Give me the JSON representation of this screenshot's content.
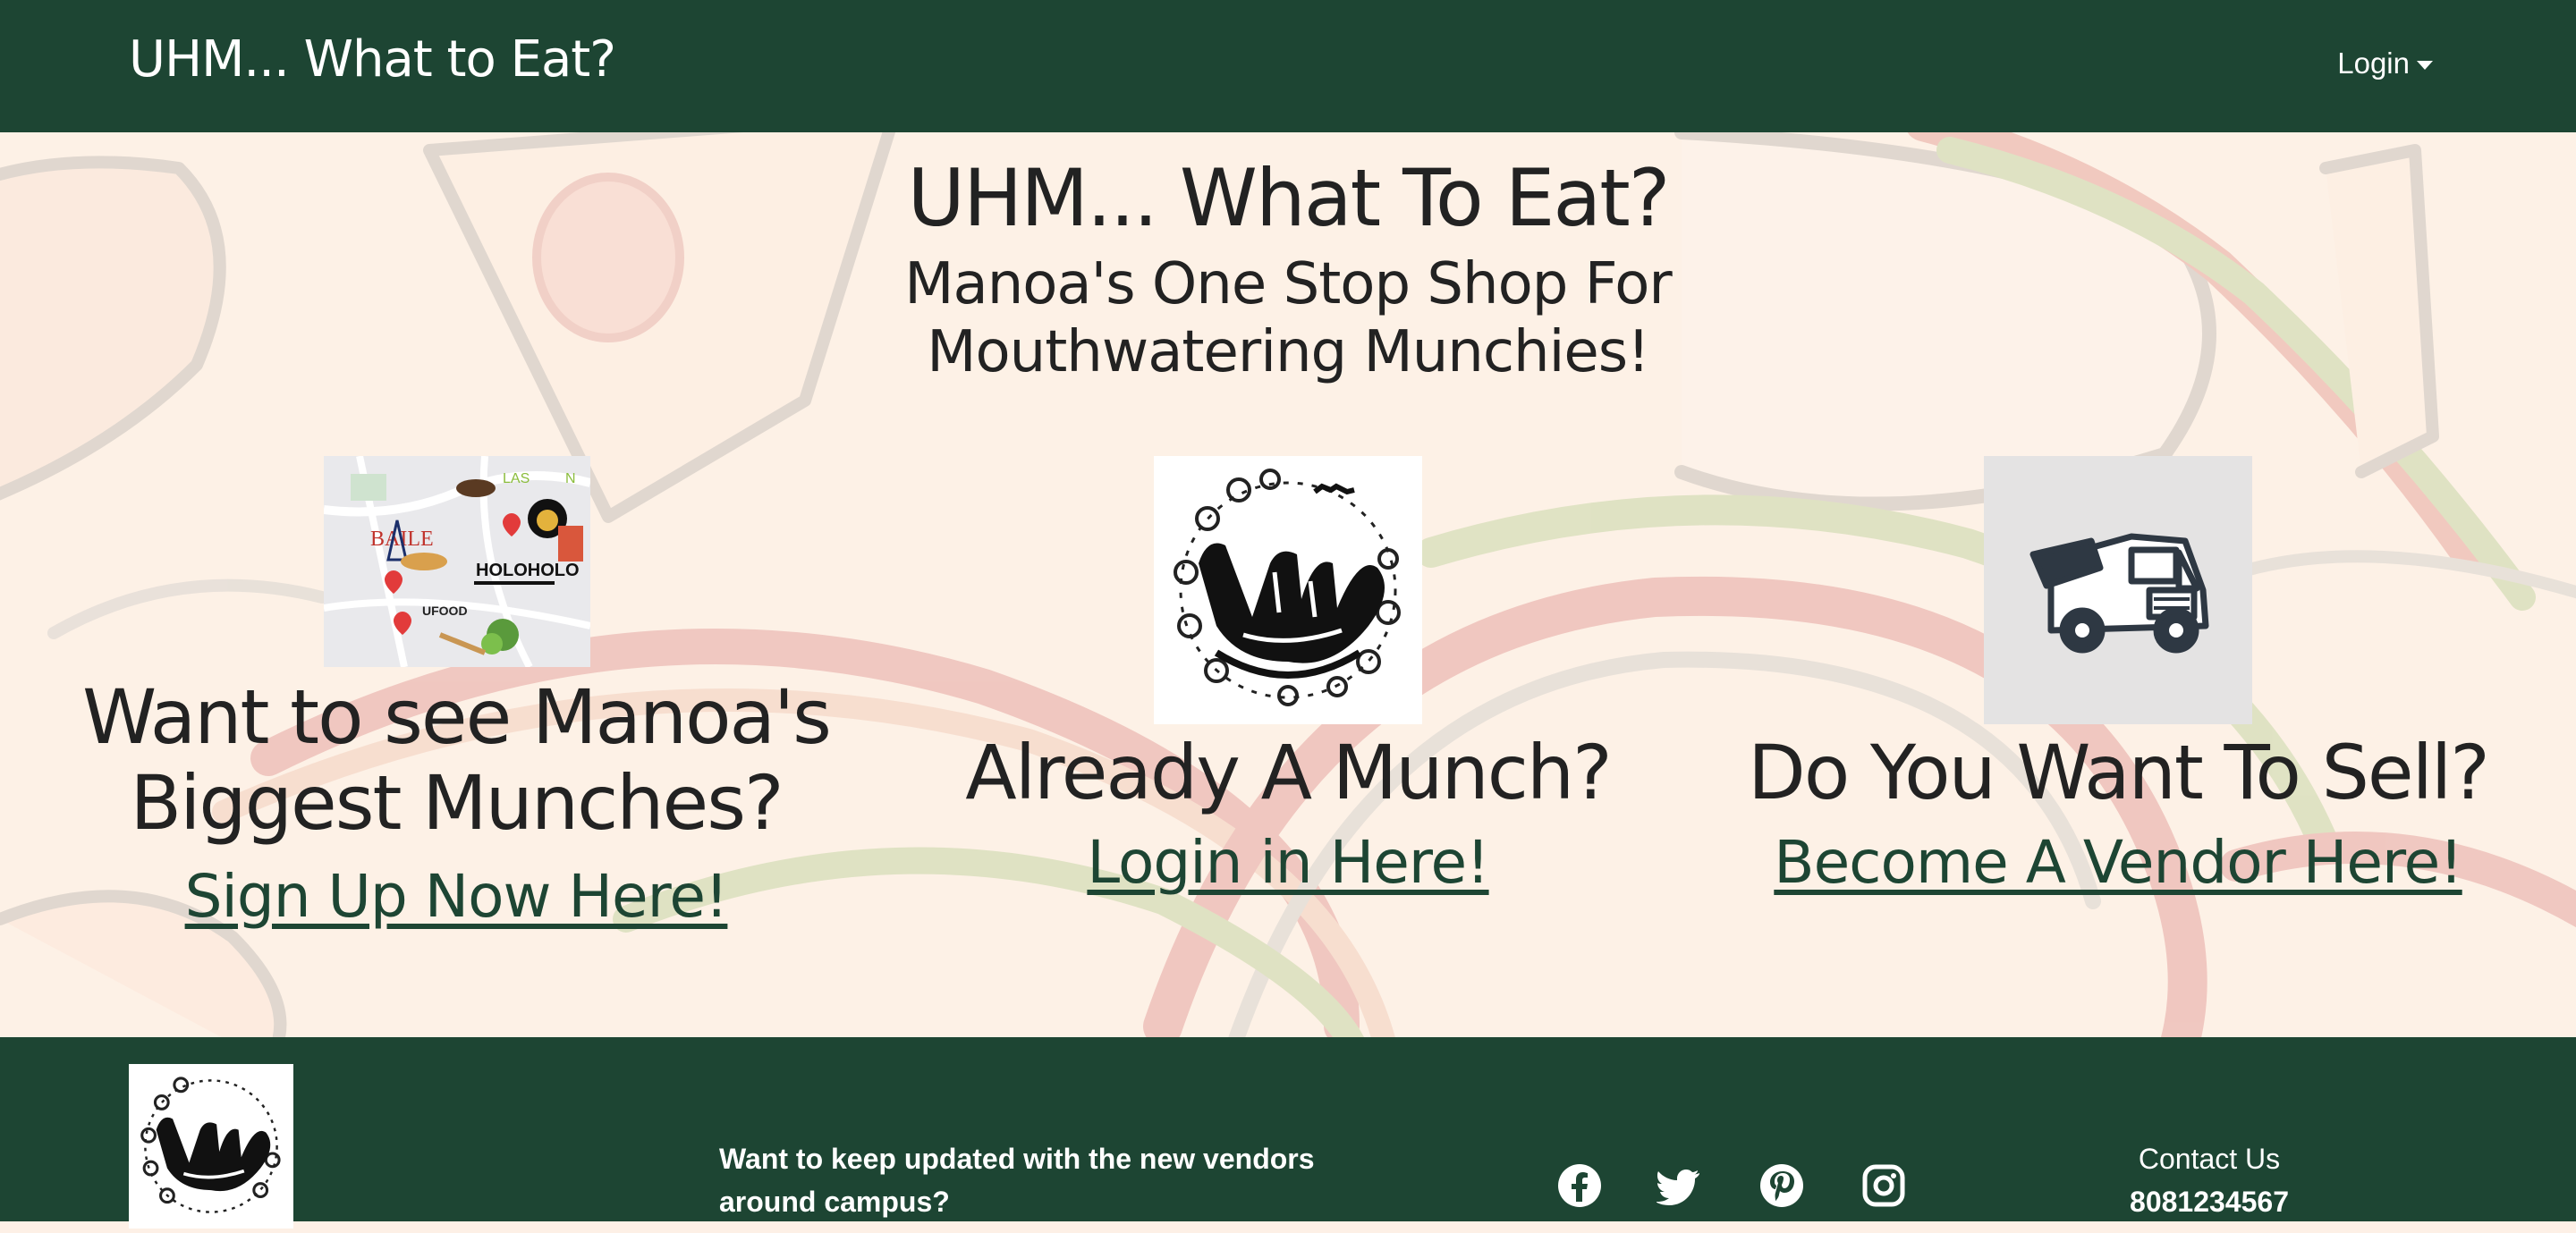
{
  "navbar": {
    "brand": "UHM... What to Eat?",
    "login_label": "Login"
  },
  "hero": {
    "title": "UHM... What To Eat?",
    "subtitle": "Manoa's One Stop Shop For Mouthwatering Munchies!"
  },
  "columns": [
    {
      "heading": "Want to see Manoa's Biggest Munches?",
      "link": "Sign Up Now Here!",
      "image": "campus-food-map",
      "map_labels": [
        "BAILE",
        "HOLOHOLO",
        "LAS",
        "N",
        "UFOOD"
      ]
    },
    {
      "heading": "Already A Munch?",
      "link": "Login in Here!",
      "image": "uh-pride-shaka-logo"
    },
    {
      "heading": "Do You Want To Sell?",
      "link": "Become A Vendor Here!",
      "image": "food-truck-icon"
    }
  ],
  "footer": {
    "logo": "uh-pride-shaka-logo",
    "newsletter_text": "Want to keep updated with the new vendors around campus?",
    "social_icons": [
      "facebook-icon",
      "twitter-icon",
      "pinterest-icon",
      "instagram-icon"
    ],
    "contact_title": "Contact Us",
    "contact_phone": "8081234567"
  },
  "colors": {
    "primary_green": "#1d4533",
    "hero_background": "#fdf1e6",
    "text_dark": "#222222"
  }
}
